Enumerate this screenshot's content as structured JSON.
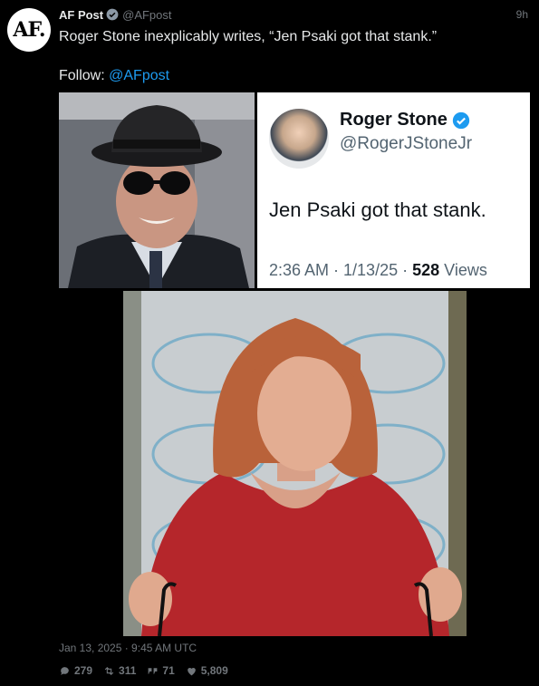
{
  "author": {
    "avatar_text": "AF.",
    "name": "AF Post",
    "handle": "@AFpost",
    "time": "9h"
  },
  "tweet": {
    "text": "Roger Stone inexplicably writes, “Jen Psaki got that stank.”",
    "follow_prefix": "Follow: ",
    "follow_link": "@AFpost"
  },
  "embedded_tweet": {
    "name": "Roger Stone",
    "handle": "@RogerJStoneJr",
    "text": "Jen Psaki got that stank.",
    "meta_prefix": "2:36 AM · 1/13/25 · ",
    "views_count": "528",
    "views_label": " Views"
  },
  "footer": {
    "date": "Jan 13, 2025 · 9:45 AM UTC",
    "replies": "279",
    "retweets": "311",
    "quotes": "71",
    "likes": "5,809"
  },
  "colors": {
    "accent": "#1d9bf0",
    "muted": "#71767b",
    "background": "#000000",
    "text": "#e7e9ea"
  }
}
